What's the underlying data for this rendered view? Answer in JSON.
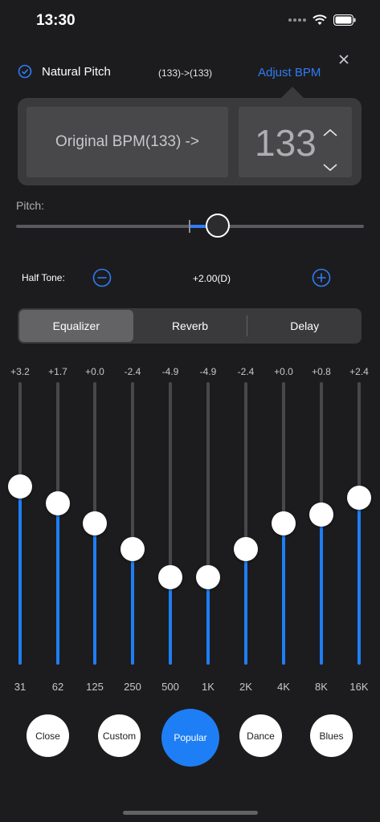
{
  "status_bar": {
    "time": "13:30"
  },
  "top": {
    "natural_pitch_label": "Natural Pitch",
    "natural_pitch_checked": true,
    "bpm_change": "(133)->(133)",
    "adjust_bpm_label": "Adjust BPM"
  },
  "bpm_popover": {
    "original_label": "Original BPM(133) ->",
    "value": "133"
  },
  "pitch": {
    "label": "Pitch:",
    "level": 0.57
  },
  "half_tone": {
    "label": "Half Tone:",
    "value": "+2.00(D)"
  },
  "tabs": [
    {
      "label": "Equalizer",
      "active": true
    },
    {
      "label": "Reverb",
      "active": false
    },
    {
      "label": "Delay",
      "active": false
    }
  ],
  "equalizer": {
    "bands": [
      {
        "freq": "31",
        "value": "+3.2",
        "level": 0.63
      },
      {
        "freq": "62",
        "value": "+1.7",
        "level": 0.57
      },
      {
        "freq": "125",
        "value": "+0.0",
        "level": 0.5
      },
      {
        "freq": "250",
        "value": "-2.4",
        "level": 0.41
      },
      {
        "freq": "500",
        "value": "-4.9",
        "level": 0.31
      },
      {
        "freq": "1K",
        "value": "-4.9",
        "level": 0.31
      },
      {
        "freq": "2K",
        "value": "-2.4",
        "level": 0.41
      },
      {
        "freq": "4K",
        "value": "+0.0",
        "level": 0.5
      },
      {
        "freq": "8K",
        "value": "+0.8",
        "level": 0.53
      },
      {
        "freq": "16K",
        "value": "+2.4",
        "level": 0.59
      }
    ]
  },
  "presets": [
    {
      "label": "Close",
      "active": false
    },
    {
      "label": "Custom",
      "active": false
    },
    {
      "label": "Popular",
      "active": true
    },
    {
      "label": "Dance",
      "active": false
    },
    {
      "label": "Blues",
      "active": false
    }
  ],
  "colors": {
    "accent": "#1e7ef5",
    "background": "#1c1c1e",
    "panel": "#3a3a3c"
  }
}
